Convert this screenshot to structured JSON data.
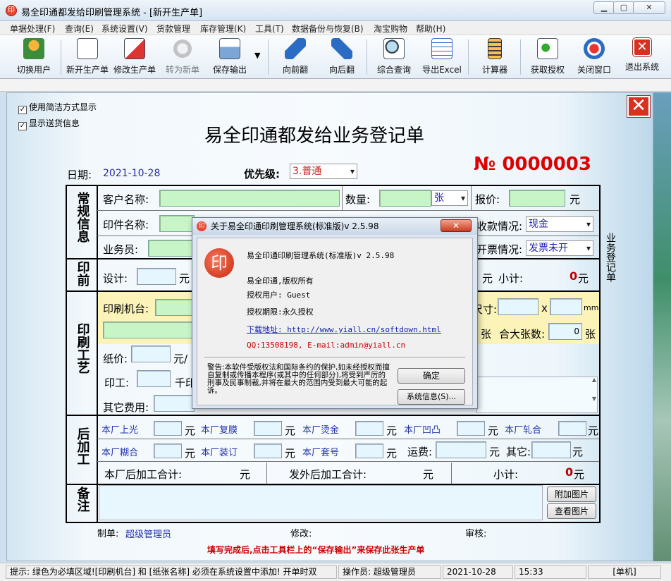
{
  "window": {
    "title": "易全印通都发给印刷管理系统 - [新开生产单]",
    "icon_glyph": "印"
  },
  "menu": [
    "单据处理(F)",
    "查询(E)",
    "系统设置(V)",
    "货款管理",
    "库存管理(K)",
    "工具(T)",
    "数据备份与恢复(B)",
    "淘宝购物",
    "帮助(H)"
  ],
  "toolbar": {
    "switch_user": "切换用户",
    "new_order": "新开生产单",
    "edit_order": "修改生产单",
    "to_new": "转为新单",
    "save_output": "保存输出",
    "prev": "向前翻",
    "next": "向后翻",
    "query": "综合查询",
    "export": "导出Excel",
    "calc": "计算器",
    "license": "获取授权",
    "close_win": "关闭窗口",
    "exit": "退出系统"
  },
  "options": {
    "simple_mode": "使用简洁方式显示",
    "show_delivery": "显示送货信息"
  },
  "form": {
    "title": "易全印通都发给业务登记单",
    "date_label": "日期:",
    "date": "2021-10-28",
    "priority_label": "优先级:",
    "priority": "3.普通",
    "number_symbol": "№",
    "number": "0000003",
    "sec_regular": "常规信息",
    "sec_prepress": "印前",
    "sec_print": "印刷工艺",
    "sec_post": "后加工",
    "sec_note": "备注",
    "customer": "客户名称:",
    "qty": "数量:",
    "qty_unit": "张",
    "quote": "报价:",
    "yuan": "元",
    "job_name": "印件名称:",
    "payment_label": "收款情况:",
    "payment": "现金",
    "sales": "业务员:",
    "invoice_label": "开票情况:",
    "invoice": "发票未开",
    "side_note": "业务登记单",
    "design": "设计:",
    "subtotal": "小计:",
    "subtotal_val": "0",
    "press": "印刷机台:",
    "size": "尺寸:",
    "x": "x",
    "mm": "mm",
    "zhang": "张",
    "big_sheets": "合大张数:",
    "big_sheets_val": "0",
    "paper_price": "纸价:",
    "paper_unit": "元/",
    "labor": "印工:",
    "thousand": "千印",
    "other_fee": "其它费用:",
    "post_items": [
      "本厂上光",
      "本厂复膜",
      "本厂烫金",
      "本厂凹凸",
      "本厂轧合",
      "本厂糊合",
      "本厂装订",
      "本厂套号"
    ],
    "freight": "运费:",
    "other": "其它:",
    "inhouse_total": "本厂后加工合计:",
    "outside_total": "发外后加工合计:",
    "post_subtotal": "小计:",
    "post_subtotal_val": "0",
    "add_image": "附加图片",
    "view_image": "查看图片",
    "maker_label": "制单:",
    "maker": "超级管理员",
    "modify_label": "修改:",
    "audit_label": "审核:",
    "hint": "填写完成后,点击工具栏上的“保存输出”来保存此张生产单"
  },
  "dialog": {
    "title": "关于易全印通印刷管理系统(标准版)v 2.5.98",
    "close": "✕",
    "logo": "印",
    "product": "易全印通印刷管理系统(标准版)v 2.5.98",
    "copyright": "易全印通,版权所有",
    "user": "授权用户: Guest",
    "period": "授权期限:永久授权",
    "download_label": "下载地址:",
    "download_url": "http://www.yiall.cn/softdown.html",
    "contact": "QQ:13508198,  E-mail:admin@yiall.cn",
    "warning": "警告:本软件受版权法和国际条约的保护,如未经授权而擅自复制或传播本程序(或其中的任何部分),将受到严厉的刑事及民事制裁,并将在最大的范围内受到最大可能的起诉。",
    "ok": "确定",
    "sysinfo": "系统信息(S)..."
  },
  "status": {
    "hint": "提示: 绿色为必填区域![印刷机台] 和 [纸张名称] 必须在系统设置中添加! 开单时双",
    "operator": "操作员: 超级管理员",
    "date": "2021-10-28",
    "time": "15:33",
    "mode": "[单机]"
  }
}
